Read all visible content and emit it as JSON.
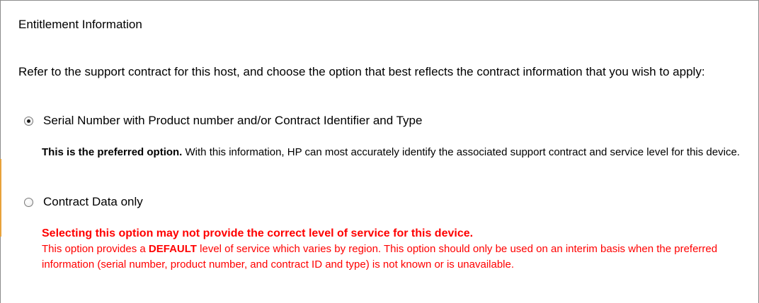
{
  "section": {
    "title": "Entitlement Information"
  },
  "intro": {
    "text": "Refer to the support contract for this host, and choose the option that best reflects the contract information that you wish to apply:"
  },
  "options": [
    {
      "label": "Serial Number with Product number and/or Contract Identifier and Type",
      "selected": true,
      "desc_bold": "This is the preferred option.",
      "desc_text": " With this information, HP can most accurately identify the associated support contract and service level for this device."
    },
    {
      "label": "Contract Data only",
      "selected": false,
      "warning_headline": "Selecting this option may not provide the correct level of service for this device.",
      "warning_pre": "This option provides a ",
      "warning_bold": "DEFAULT",
      "warning_post": " level of service which varies by region. This option should only be used on an interim basis when the preferred information (serial number, product number, and contract ID and type) is not known or is unavailable."
    }
  ],
  "colors": {
    "warning": "#ff0000",
    "border": "#8c8c8c",
    "accent": "#e8a23a"
  }
}
